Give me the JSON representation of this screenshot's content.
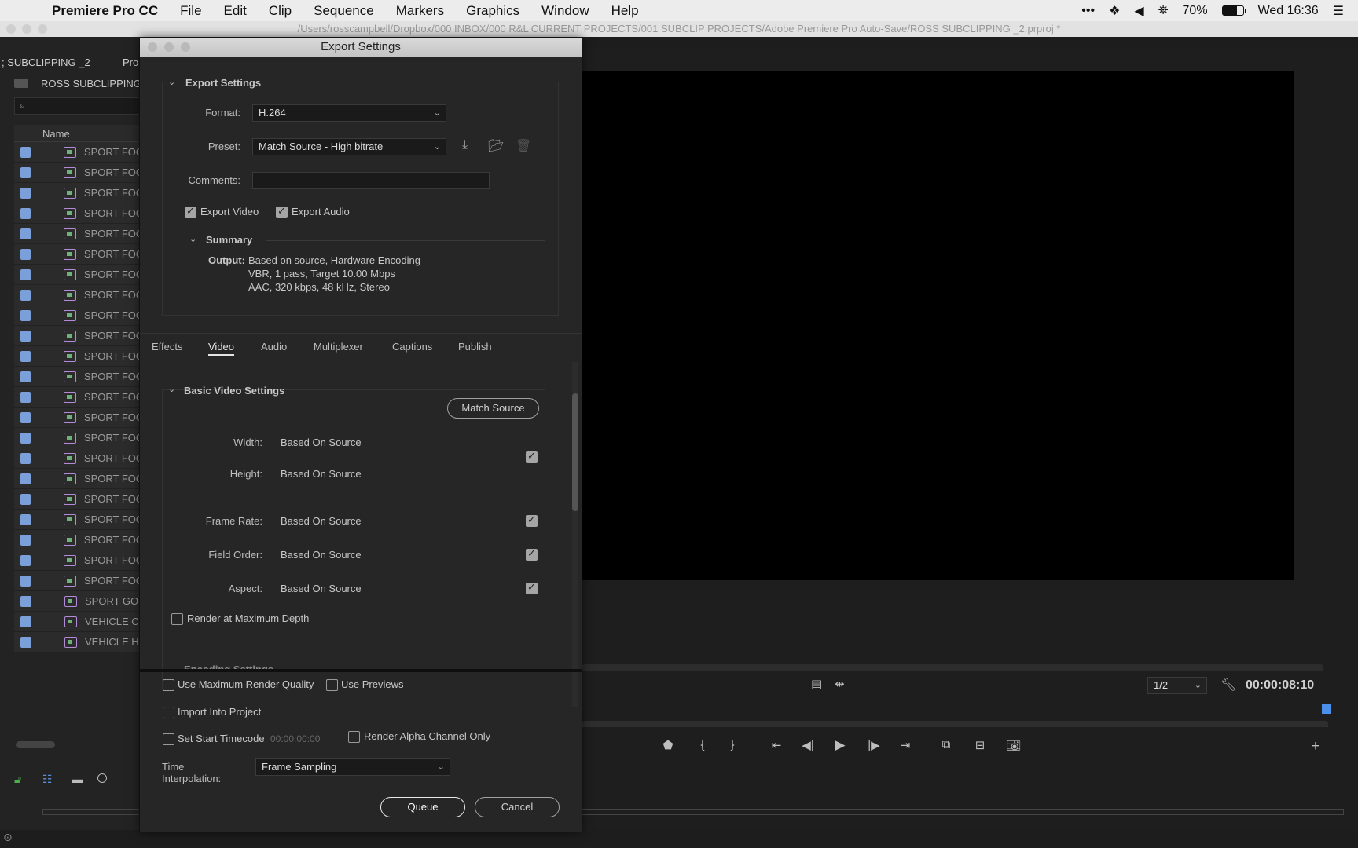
{
  "menubar": {
    "app": "Premiere Pro CC",
    "items": [
      "File",
      "Edit",
      "Clip",
      "Sequence",
      "Markers",
      "Graphics",
      "Window",
      "Help"
    ],
    "battery": "70%",
    "clock": "Wed 16:36"
  },
  "window": {
    "path": "/Users/rosscampbell/Dropbox/000 INBOX/000 R&L CURRENT PROJECTS/001 SUBCLIP PROJECTS/Adobe Premiere Pro Auto-Save/ROSS SUBCLIPPING _2.prproj *"
  },
  "project": {
    "tab_label": "; SUBCLIPPING _2",
    "tab2_label": "Pro",
    "bin_name": "ROSS SUBCLIPPING _",
    "column_name": "Name",
    "items": [
      "SPORT FOO",
      "SPORT FOO",
      "SPORT FOO",
      "SPORT FOO",
      "SPORT FOO",
      "SPORT FOO",
      "SPORT FOO",
      "SPORT FOO",
      "SPORT FOO",
      "SPORT FOO",
      "SPORT FOO",
      "SPORT FOO",
      "SPORT FOO",
      "SPORT FOO",
      "SPORT FOO",
      "SPORT FOO",
      "SPORT FOO",
      "SPORT FOO",
      "SPORT FOO",
      "SPORT FOO",
      "SPORT FOO",
      "SPORT FOO",
      "SPORT GO",
      "VEHICLE C",
      "VEHICLE H"
    ]
  },
  "monitor": {
    "zoom": "1/2",
    "timecode": "00:00:08:10"
  },
  "dialog": {
    "title": "Export Settings",
    "section_title": "Export Settings",
    "format_label": "Format:",
    "format_value": "H.264",
    "preset_label": "Preset:",
    "preset_value": "Match Source - High bitrate",
    "comments_label": "Comments:",
    "comments_value": "",
    "export_video": "Export Video",
    "export_audio": "Export Audio",
    "summary_title": "Summary",
    "output_label": "Output:",
    "output_lines": [
      "Based on source, Hardware Encoding",
      "VBR, 1 pass, Target 10.00 Mbps",
      "AAC, 320 kbps, 48 kHz, Stereo"
    ],
    "tabs": [
      "Effects",
      "Video",
      "Audio",
      "Multiplexer",
      "Captions",
      "Publish"
    ],
    "active_tab": "Video",
    "basic_video_title": "Basic Video Settings",
    "match_source": "Match Source",
    "fields": [
      {
        "label": "Width:",
        "value": "Based On Source"
      },
      {
        "label": "Height:",
        "value": "Based On Source"
      },
      {
        "label": "Frame Rate:",
        "value": "Based On Source"
      },
      {
        "label": "Field Order:",
        "value": "Based On Source"
      },
      {
        "label": "Aspect:",
        "value": "Based On Source"
      }
    ],
    "render_max_depth": "Render at Maximum Depth",
    "encoding_settings": "Encoding Settings",
    "use_max_render_quality": "Use Maximum Render Quality",
    "use_previews": "Use Previews",
    "import_into_project": "Import Into Project",
    "set_start_timecode": "Set Start Timecode",
    "start_timecode": "00:00:00:00",
    "render_alpha": "Render Alpha Channel Only",
    "time_interp_label": "Time Interpolation:",
    "time_interp_value": "Frame Sampling",
    "queue": "Queue",
    "cancel": "Cancel"
  }
}
